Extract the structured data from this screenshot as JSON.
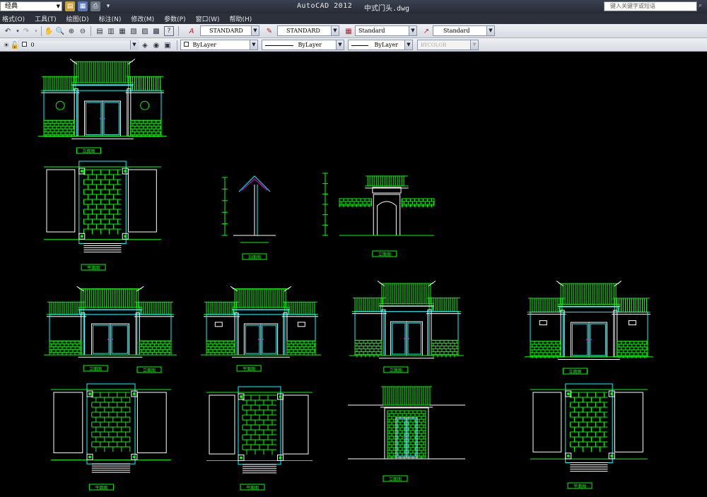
{
  "titlebar": {
    "workspace": "经典",
    "app_title": "AutoCAD 2012",
    "doc_title": "中式门头.dwg",
    "search_placeholder": "键入关键字或短语"
  },
  "menus": [
    "格式(O)",
    "工具(T)",
    "绘图(D)",
    "标注(N)",
    "修改(M)",
    "参数(P)",
    "窗口(W)",
    "帮助(H)"
  ],
  "toolbar1": {
    "text_style": "STANDARD",
    "dim_style": "STANDARD",
    "table_style": "Standard",
    "mleader_style": "Standard"
  },
  "toolbar2": {
    "layer": "0",
    "color": "ByLayer",
    "linetype": "ByLayer",
    "lineweight": "ByLayer",
    "plotstyle": "BYCOLOR"
  },
  "colors": {
    "canvas": "#000000",
    "green": "#00ff00",
    "cyan": "#00ffff",
    "white": "#ffffff",
    "magenta": "#ff00ff"
  },
  "drawings": [
    {
      "label": "立面图"
    },
    {
      "label": "平面图"
    },
    {
      "label": "剖面图"
    },
    {
      "label": "立面图"
    },
    {
      "label": "立面图"
    },
    {
      "label": "平面图"
    },
    {
      "label": "立面图"
    },
    {
      "label": "立面图"
    },
    {
      "label": "立面图"
    },
    {
      "label": "立面图"
    },
    {
      "label": "平面图"
    },
    {
      "label": "平面图"
    },
    {
      "label": "立面图"
    },
    {
      "label": "平面图"
    }
  ]
}
